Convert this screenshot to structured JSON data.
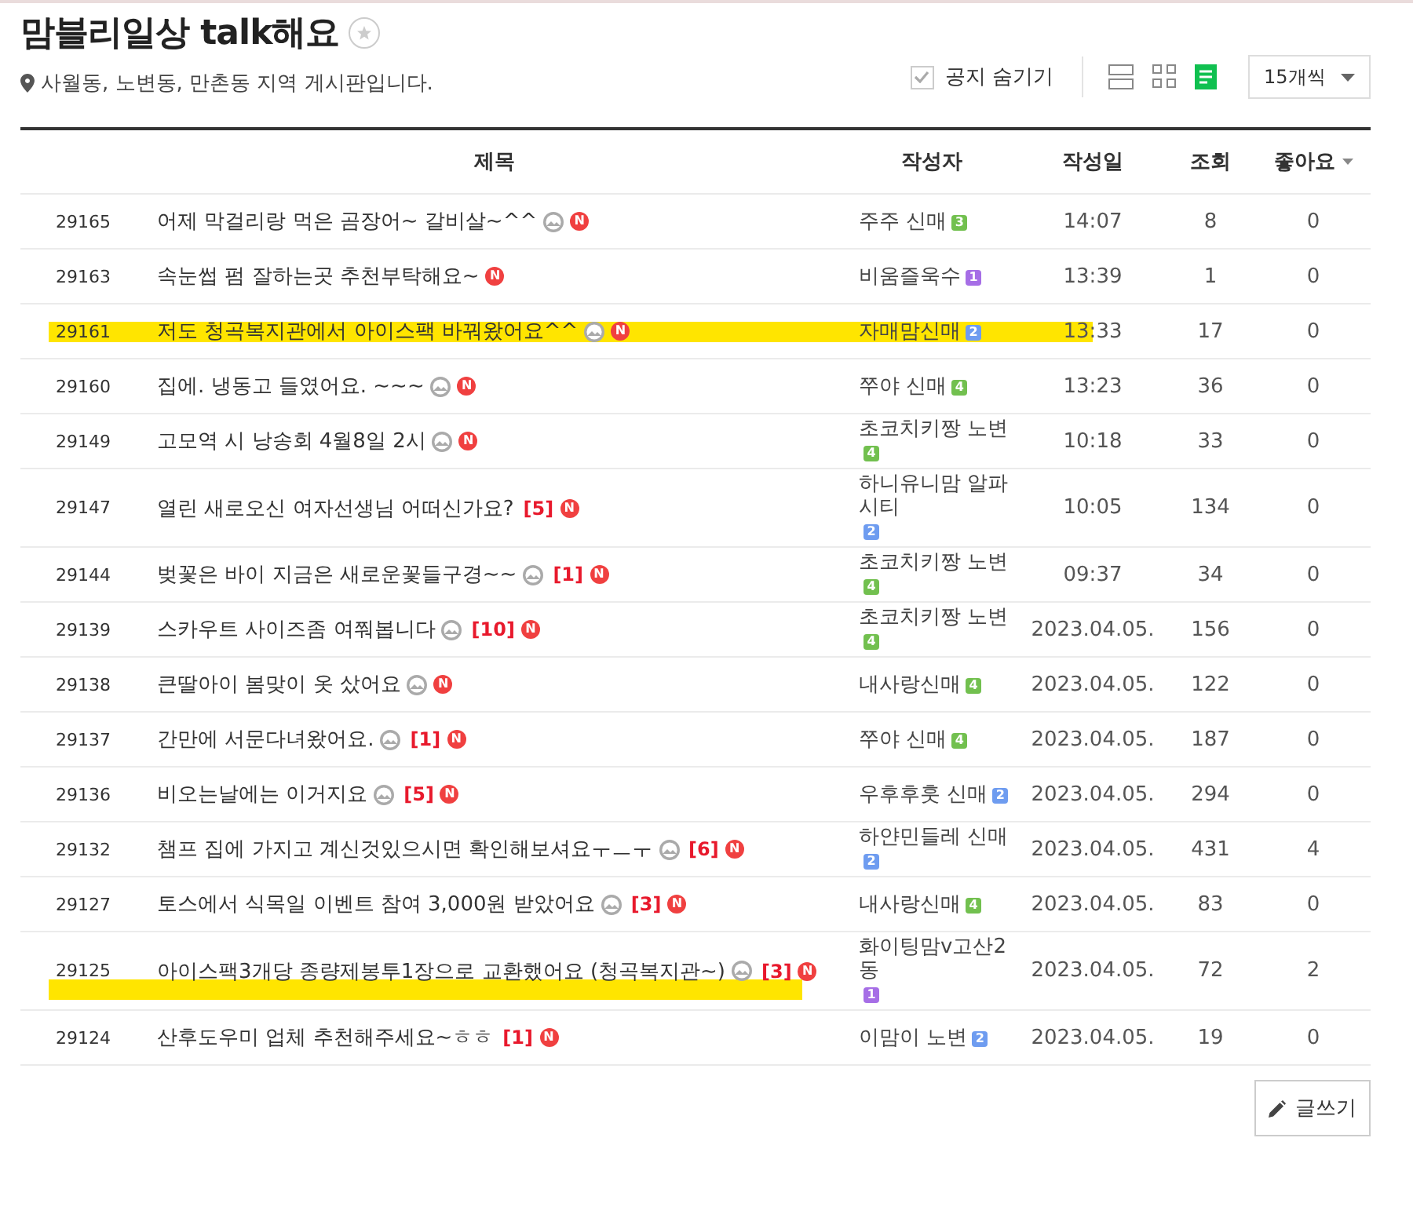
{
  "board": {
    "title": "맘블리일상 talk해요",
    "favorite": false,
    "description": "사월동, 노변동, 만촌동 지역 게시판입니다."
  },
  "toolbar": {
    "hide_notice": {
      "label": "공지 숨기기",
      "checked": true
    },
    "views": [
      {
        "kind": "card",
        "selected": false
      },
      {
        "kind": "album",
        "selected": false
      },
      {
        "kind": "list",
        "selected": true
      }
    ],
    "page_size": "15개씩"
  },
  "table": {
    "columns": [
      "제목",
      "작성자",
      "작성일",
      "조회",
      "좋아요"
    ],
    "rows": [
      {
        "number": "29165",
        "title": {
          "text": "어제 막걸리랑 먹은 곰장어~ 갈비살~^^",
          "has_image": true,
          "new_badge": "N"
        },
        "author": {
          "name": "주주 신매",
          "grade": "3",
          "color": "#72c04f"
        },
        "date": "14:07",
        "views": "8",
        "likes": "0",
        "highlighted": false
      },
      {
        "number": "29163",
        "title": {
          "text": "속눈썹 펌 잘하는곳 추천부탁해요~",
          "has_image": false,
          "new_badge": "N"
        },
        "author": {
          "name": "비움즐욱수",
          "grade": "1",
          "color": "#a66ee6"
        },
        "date": "13:39",
        "views": "1",
        "likes": "0",
        "highlighted": false
      },
      {
        "number": "29161",
        "title": {
          "text": "저도 청곡복지관에서 아이스팩 바꿔왔어요^^",
          "has_image": true,
          "new_badge": "N"
        },
        "author": {
          "name": "자매맘신매",
          "grade": "2",
          "color": "#6e9cf0"
        },
        "date": "13:33",
        "views": "17",
        "likes": "0",
        "highlighted": true
      },
      {
        "number": "29160",
        "title": {
          "text": "집에. 냉동고 들였어요. ~~~",
          "has_image": true,
          "new_badge": "N"
        },
        "author": {
          "name": "쭈야 신매",
          "grade": "4",
          "color": "#72c04f"
        },
        "date": "13:23",
        "views": "36",
        "likes": "0",
        "highlighted": false
      },
      {
        "number": "29149",
        "title": {
          "text": "고모역 시 낭송회 4월8일 2시",
          "has_image": true,
          "new_badge": "N"
        },
        "author": {
          "name": "초코치키짱 노변",
          "grade": "4",
          "color": "#72c04f"
        },
        "date": "10:18",
        "views": "33",
        "likes": "0",
        "highlighted": false
      },
      {
        "number": "29147",
        "title": {
          "text": "열린 새로오신 여자선생님 어떠신가요?",
          "has_image": false,
          "comments": "[5]",
          "new_badge": "N"
        },
        "author": {
          "name": "하니유니맘 알파시티",
          "grade": "2",
          "color": "#6e9cf0"
        },
        "date": "10:05",
        "views": "134",
        "likes": "0",
        "highlighted": false
      },
      {
        "number": "29144",
        "title": {
          "text": "벚꽃은 바이 지금은 새로운꽃들구경~~",
          "has_image": true,
          "comments": "[1]",
          "new_badge": "N"
        },
        "author": {
          "name": "초코치키짱 노변",
          "grade": "4",
          "color": "#72c04f"
        },
        "date": "09:37",
        "views": "34",
        "likes": "0",
        "highlighted": false
      },
      {
        "number": "29139",
        "title": {
          "text": "스카우트 사이즈좀 여쭤봅니다",
          "has_image": true,
          "comments": "[10]",
          "new_badge": "N"
        },
        "author": {
          "name": "초코치키짱 노변",
          "grade": "4",
          "color": "#72c04f"
        },
        "date": "2023.04.05.",
        "views": "156",
        "likes": "0",
        "highlighted": false
      },
      {
        "number": "29138",
        "title": {
          "text": "큰딸아이 봄맞이 옷 샀어요",
          "has_image": true,
          "new_badge": "N"
        },
        "author": {
          "name": "내사랑신매",
          "grade": "4",
          "color": "#72c04f"
        },
        "date": "2023.04.05.",
        "views": "122",
        "likes": "0",
        "highlighted": false
      },
      {
        "number": "29137",
        "title": {
          "text": "간만에 서문다녀왔어요.",
          "has_image": true,
          "comments": "[1]",
          "new_badge": "N"
        },
        "author": {
          "name": "쭈야 신매",
          "grade": "4",
          "color": "#72c04f"
        },
        "date": "2023.04.05.",
        "views": "187",
        "likes": "0",
        "highlighted": false
      },
      {
        "number": "29136",
        "title": {
          "text": "비오는날에는 이거지요",
          "has_image": true,
          "comments": "[5]",
          "new_badge": "N"
        },
        "author": {
          "name": "우후후훗 신매",
          "grade": "2",
          "color": "#6e9cf0"
        },
        "date": "2023.04.05.",
        "views": "294",
        "likes": "0",
        "highlighted": false
      },
      {
        "number": "29132",
        "title": {
          "text": "챔프 집에 가지고 계신것있으시면 확인해보셔요ㅜㅡㅜ",
          "has_image": true,
          "comments": "[6]",
          "new_badge": "N"
        },
        "author": {
          "name": "하얀민들레 신매",
          "grade": "2",
          "color": "#6e9cf0"
        },
        "date": "2023.04.05.",
        "views": "431",
        "likes": "4",
        "highlighted": false
      },
      {
        "number": "29127",
        "title": {
          "text": "토스에서 식목일 이벤트 참여 3,000원 받았어요",
          "has_image": true,
          "comments": "[3]",
          "new_badge": "N"
        },
        "author": {
          "name": "내사랑신매",
          "grade": "4",
          "color": "#72c04f"
        },
        "date": "2023.04.05.",
        "views": "83",
        "likes": "0",
        "highlighted": false
      },
      {
        "number": "29125",
        "title": {
          "text": "아이스팩3개당 종량제봉투1장으로 교환했어요 (청곡복지관~)",
          "has_image": true,
          "comments": "[3]",
          "new_badge": "N"
        },
        "author": {
          "name": "화이팅맘v고산2동",
          "grade": "1",
          "color": "#a66ee6"
        },
        "date": "2023.04.05.",
        "views": "72",
        "likes": "2",
        "highlighted": true
      },
      {
        "number": "29124",
        "title": {
          "text": "산후도우미 업체 추천해주세요~ㅎㅎ",
          "has_image": false,
          "comments": "[1]",
          "new_badge": "N"
        },
        "author": {
          "name": "이맘이 노변",
          "grade": "2",
          "color": "#6e9cf0"
        },
        "date": "2023.04.05.",
        "views": "19",
        "likes": "0",
        "highlighted": false
      }
    ]
  },
  "write_button": "글쓰기"
}
